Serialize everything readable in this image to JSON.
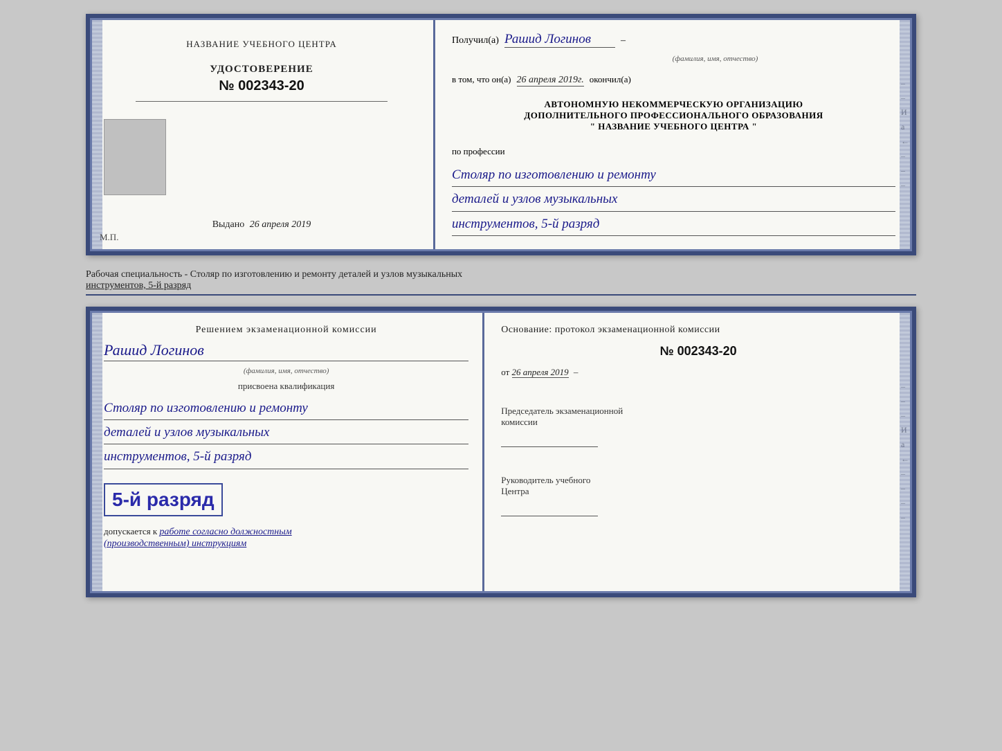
{
  "topCert": {
    "left": {
      "centerTitle": "НАЗВАНИЕ УЧЕБНОГО ЦЕНТРА",
      "udostoverenie": "УДОСТОВЕРЕНИЕ",
      "number": "№ 002343-20",
      "vydanoLabel": "Выдано",
      "vydanoDate": "26 апреля 2019",
      "mpLabel": "М.П."
    },
    "right": {
      "poluchilLabel": "Получил(a)",
      "recipientName": "Рашид Логинов",
      "fioSublabel": "(фамилия, имя, отчество)",
      "vtomChtoLabel": "в том, что он(а)",
      "vtomChtoDate": "26 апреля 2019г.",
      "okonchilLabel": "окончил(а)",
      "orgLine1": "АВТОНОМНУЮ НЕКОММЕРЧЕСКУЮ ОРГАНИЗАЦИЮ",
      "orgLine2": "ДОПОЛНИТЕЛЬНОГО ПРОФЕССИОНАЛЬНОГО ОБРАЗОВАНИЯ",
      "orgLine3": "\"   НАЗВАНИЕ УЧЕБНОГО ЦЕНТРА   \"",
      "poProf": "по профессии",
      "profLine1": "Столяр по изготовлению и ремонту",
      "profLine2": "деталей и узлов музыкальных",
      "profLine3": "инструментов, 5-й разряд"
    }
  },
  "infoText": {
    "main": "Рабочая специальность - Столяр по изготовлению и ремонту деталей и узлов музыкальных",
    "underline": "инструментов, 5-й разряд"
  },
  "bottomCert": {
    "left": {
      "decisionTitle": "Решением экзаменационной комиссии",
      "recipientName": "Рашид Логинов",
      "fioSublabel": "(фамилия, имя, отчество)",
      "prisvoenLabel": "присвоена квалификация",
      "profLine1": "Столяр по изготовлению и ремонту",
      "profLine2": "деталей и узлов музыкальных",
      "profLine3": "инструментов, 5-й разряд",
      "razryadText": "5-й разряд",
      "dopuskaetsyaLabel": "допускается к",
      "dopuskaetsyaText": "работе согласно должностным",
      "instrLabel": "(производственным) инструкциям"
    },
    "right": {
      "osnovLabel": "Основание: протокол экзаменационной комиссии",
      "protocolNumber": "№ 002343-20",
      "otLabel": "от",
      "otDate": "26 апреля 2019",
      "predsedatelLabel": "Председатель экзаменационной",
      "predsedatelLabel2": "комиссии",
      "rukovoditLabel": "Руководитель учебного",
      "rukovoditLabel2": "Центра"
    }
  },
  "sideChars": {
    "right1": "–",
    "right2": "И",
    "right3": "а",
    "right4": "←",
    "right5": "–",
    "right6": "–",
    "right7": "–"
  }
}
